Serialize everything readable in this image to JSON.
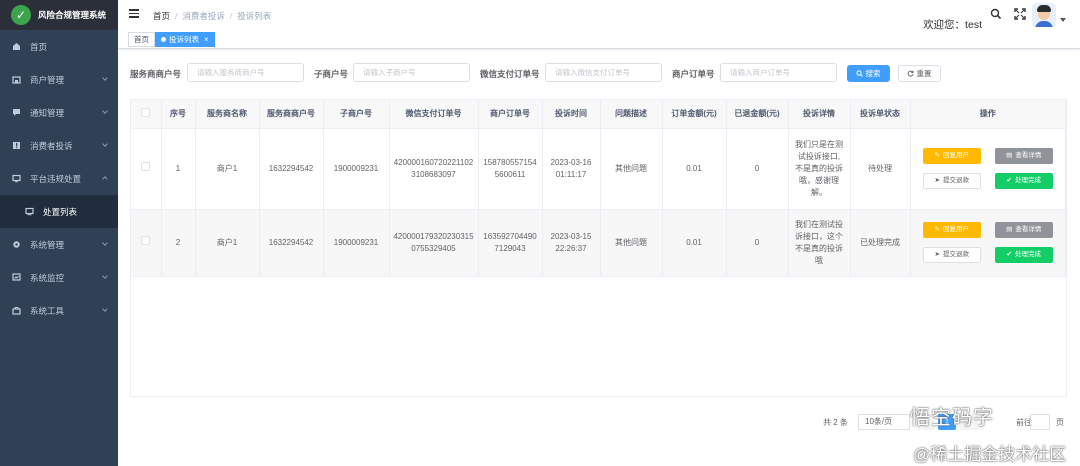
{
  "app": {
    "title": "风险合规管理系统"
  },
  "sidebar": {
    "items": [
      {
        "label": "首页",
        "icon": "dashboard-icon"
      },
      {
        "label": "商户管理",
        "icon": "shop-icon"
      },
      {
        "label": "通知管理",
        "icon": "message-icon"
      },
      {
        "label": "消费者投诉",
        "icon": "alert-icon"
      },
      {
        "label": "平台违规处置",
        "icon": "monitor-icon"
      },
      {
        "label": "处置列表",
        "icon": "list-icon"
      },
      {
        "label": "系统管理",
        "icon": "gear-icon"
      },
      {
        "label": "系统监控",
        "icon": "chart-icon"
      },
      {
        "label": "系统工具",
        "icon": "toolbox-icon"
      }
    ]
  },
  "header": {
    "breadcrumb": [
      "首页",
      "消费者投诉",
      "投诉列表"
    ],
    "welcome": "欢迎您：test"
  },
  "tags": [
    {
      "label": "首页"
    },
    {
      "label": "投诉列表",
      "close": "×"
    }
  ],
  "search": {
    "fields": [
      {
        "label": "服务商商户号",
        "placeholder": "请输入服务商商户号"
      },
      {
        "label": "子商户号",
        "placeholder": "请输入子商户号"
      },
      {
        "label": "微信支付订单号",
        "placeholder": "请输入微信支付订单号"
      },
      {
        "label": "商户订单号",
        "placeholder": "请输入商户订单号"
      }
    ],
    "search_label": "搜索",
    "reset_label": "重置"
  },
  "table": {
    "headers": [
      "序号",
      "服务商名称",
      "服务商商户号",
      "子商户号",
      "微信支付订单号",
      "商户订单号",
      "投诉时间",
      "问题描述",
      "订单金额(元)",
      "已退金额(元)",
      "投诉详情",
      "投诉单状态",
      "操作"
    ],
    "rows": [
      {
        "index": "1",
        "name": "商户1",
        "sp_mchid": "1632294542",
        "sub_mchid": "1900009231",
        "wx_order": "4200001607202211023108683097",
        "mch_order": "1587805571545600611",
        "time_date": "2023-03-16",
        "time_clock": "01:11:17",
        "problem": "其他问题",
        "amount": "0.01",
        "refund": "0",
        "detail": "我们只是在测试投诉接口,不是真的投诉哦，感谢理解。",
        "status": "待处理"
      },
      {
        "index": "2",
        "name": "商户1",
        "sp_mchid": "1632294542",
        "sub_mchid": "1900009231",
        "wx_order": "4200001793202303150755329405",
        "mch_order": "1635927044907129043",
        "time_date": "2023-03-15",
        "time_clock": "22:26:37",
        "problem": "其他问题",
        "amount": "0.01",
        "refund": "0",
        "detail": "我们在测试投诉接口，这个不是真的投诉哦",
        "status": "已处理完成"
      }
    ],
    "actions": {
      "reply": "回复用户",
      "view": "查看详情",
      "refund": "提交退款",
      "complete": "处理完成"
    }
  },
  "pagination": {
    "total": "共 2 条",
    "page_size": "10条/页",
    "current": "1",
    "jump": "前往",
    "page_unit": "页"
  },
  "watermark": {
    "top": "悟空码字",
    "bottom": "@稀土掘金技术社区"
  },
  "colors": {
    "sidebar_bg": "#304156",
    "primary": "#409eff",
    "warning": "#ffba00",
    "info": "#909399",
    "success": "#13ce66"
  }
}
